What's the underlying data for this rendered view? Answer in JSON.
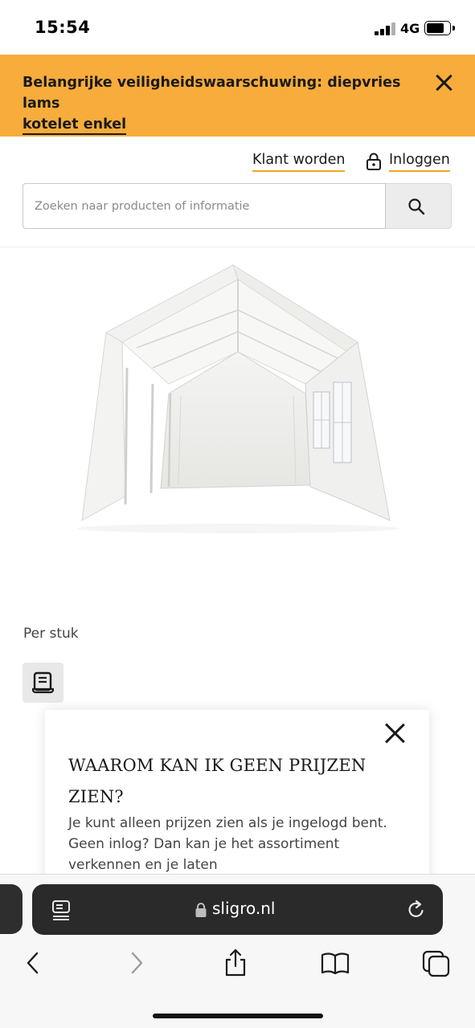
{
  "status_bar": {
    "time": "15:54",
    "network": "4G"
  },
  "alert": {
    "text_line1": "Belangrijke veiligheidswaarschuwing: diepvries lams",
    "link_text": "kotelet enkel"
  },
  "header": {
    "become_customer": "Klant worden",
    "login": "Inloggen",
    "search_placeholder": "Zoeken naar producten of informatie"
  },
  "product": {
    "image_desc_icon": "party-tent-image",
    "unit_label": "Per stuk"
  },
  "popover": {
    "title": "WAAROM KAN IK GEEN PRIJZEN ZIEN?",
    "body": "Je kunt alleen prijzen zien als je ingelogd bent. Geen inlog? Dan kan je het assortiment verkennen en je laten"
  },
  "browser": {
    "url": "sligro.nl"
  },
  "colors": {
    "accent": "#f8ac3c",
    "underline": "#f5a623"
  }
}
